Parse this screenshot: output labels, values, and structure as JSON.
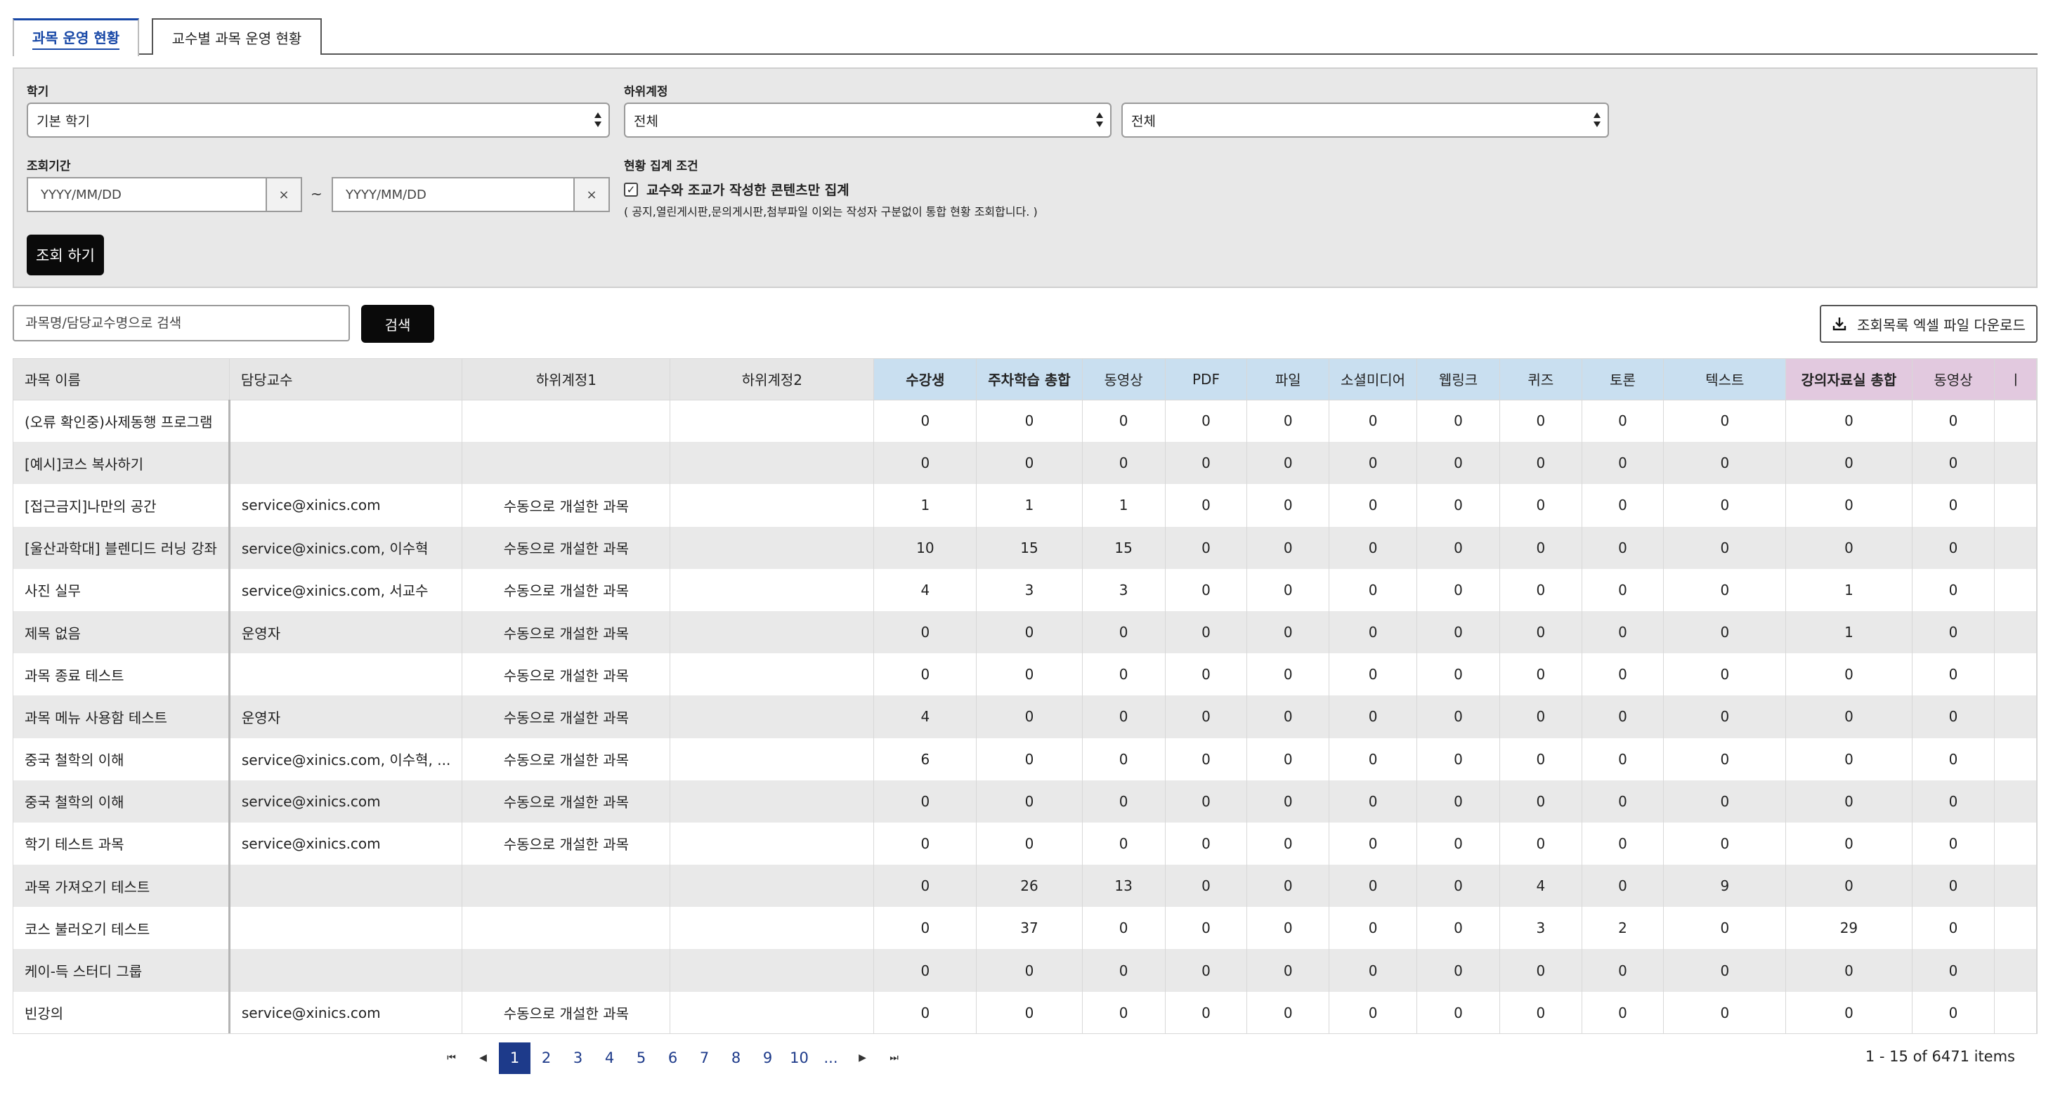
{
  "tabs": [
    {
      "label": "과목 운영 현황"
    },
    {
      "label": "교수별 과목 운영 현황"
    }
  ],
  "filters": {
    "semester_label": "학기",
    "semester_value": "기본 학기",
    "subaccount_label": "하위계정",
    "subaccount1_value": "전체",
    "subaccount2_value": "전체",
    "period_label": "조회기간",
    "date_placeholder": "YYYY/MM/DD",
    "clear_glyph": "×",
    "tilde": "~",
    "condition_label": "현황 집계 조건",
    "condition_checked": true,
    "condition_text": "교수와 조교가 작성한 콘텐츠만 집계",
    "condition_note": "( 공지,열린게시판,문의게시판,첨부파일 이외는 작성자 구분없이 통합 현황 조회합니다. )",
    "query_button": "조회 하기"
  },
  "search": {
    "placeholder": "과목명/담당교수명으로 검색",
    "button": "검색"
  },
  "download_button": "조회목록 엑셀 파일 다운로드",
  "table": {
    "columns": [
      "과목 이름",
      "담당교수",
      "하위계정1",
      "하위계정2",
      "수강생",
      "주차학습 총합",
      "동영상",
      "PDF",
      "파일",
      "소셜미디어",
      "웹링크",
      "퀴즈",
      "토론",
      "텍스트",
      "강의자료실 총합",
      "동영상",
      "ㅣ"
    ],
    "rows": [
      [
        "(오류 확인중)사제동행 프로그램",
        "",
        "",
        "",
        "0",
        "0",
        "0",
        "0",
        "0",
        "0",
        "0",
        "0",
        "0",
        "0",
        "0",
        "0"
      ],
      [
        "[예시]코스 복사하기",
        "",
        "",
        "",
        "0",
        "0",
        "0",
        "0",
        "0",
        "0",
        "0",
        "0",
        "0",
        "0",
        "0",
        "0"
      ],
      [
        "[접근금지]나만의 공간",
        "service@xinics.com",
        "수동으로 개설한 과목",
        "",
        "1",
        "1",
        "1",
        "0",
        "0",
        "0",
        "0",
        "0",
        "0",
        "0",
        "0",
        "0"
      ],
      [
        "[울산과학대] 블렌디드 러닝 강좌",
        "service@xinics.com, 이수혁",
        "수동으로 개설한 과목",
        "",
        "10",
        "15",
        "15",
        "0",
        "0",
        "0",
        "0",
        "0",
        "0",
        "0",
        "0",
        "0"
      ],
      [
        "사진 실무",
        "service@xinics.com, 서교수",
        "수동으로 개설한 과목",
        "",
        "4",
        "3",
        "3",
        "0",
        "0",
        "0",
        "0",
        "0",
        "0",
        "0",
        "1",
        "0"
      ],
      [
        "제목 없음",
        "운영자",
        "수동으로 개설한 과목",
        "",
        "0",
        "0",
        "0",
        "0",
        "0",
        "0",
        "0",
        "0",
        "0",
        "0",
        "1",
        "0"
      ],
      [
        "과목 종료 테스트",
        "",
        "수동으로 개설한 과목",
        "",
        "0",
        "0",
        "0",
        "0",
        "0",
        "0",
        "0",
        "0",
        "0",
        "0",
        "0",
        "0"
      ],
      [
        "과목 메뉴 사용함 테스트",
        "운영자",
        "수동으로 개설한 과목",
        "",
        "4",
        "0",
        "0",
        "0",
        "0",
        "0",
        "0",
        "0",
        "0",
        "0",
        "0",
        "0"
      ],
      [
        "중국 철학의 이해",
        "service@xinics.com, 이수혁, ...",
        "수동으로 개설한 과목",
        "",
        "6",
        "0",
        "0",
        "0",
        "0",
        "0",
        "0",
        "0",
        "0",
        "0",
        "0",
        "0"
      ],
      [
        "중국 철학의 이해",
        "service@xinics.com",
        "수동으로 개설한 과목",
        "",
        "0",
        "0",
        "0",
        "0",
        "0",
        "0",
        "0",
        "0",
        "0",
        "0",
        "0",
        "0"
      ],
      [
        "학기 테스트 과목",
        "service@xinics.com",
        "수동으로 개설한 과목",
        "",
        "0",
        "0",
        "0",
        "0",
        "0",
        "0",
        "0",
        "0",
        "0",
        "0",
        "0",
        "0"
      ],
      [
        "과목 가져오기 테스트",
        "",
        "",
        "",
        "0",
        "26",
        "13",
        "0",
        "0",
        "0",
        "0",
        "4",
        "0",
        "9",
        "0",
        "0"
      ],
      [
        "코스 불러오기 테스트",
        "",
        "",
        "",
        "0",
        "37",
        "0",
        "0",
        "0",
        "0",
        "0",
        "3",
        "2",
        "0",
        "29",
        "0"
      ],
      [
        "케이-득 스터디 그룹",
        "",
        "",
        "",
        "0",
        "0",
        "0",
        "0",
        "0",
        "0",
        "0",
        "0",
        "0",
        "0",
        "0",
        "0"
      ],
      [
        "빈강의",
        "service@xinics.com",
        "수동으로 개설한 과목",
        "",
        "0",
        "0",
        "0",
        "0",
        "0",
        "0",
        "0",
        "0",
        "0",
        "0",
        "0",
        "0"
      ]
    ]
  },
  "pagination": {
    "first": "⏮",
    "prev": "◀",
    "pages": [
      "1",
      "2",
      "3",
      "4",
      "5",
      "6",
      "7",
      "8",
      "9",
      "10",
      "..."
    ],
    "current": "1",
    "next": "▶",
    "last": "⏭",
    "info": "1 - 15 of 6471 items"
  },
  "colors": {
    "accent": "#1d3a8a",
    "header_gray": "#e6e6e6",
    "header_blue": "#c9dff0",
    "header_pink": "#e2c9df"
  }
}
